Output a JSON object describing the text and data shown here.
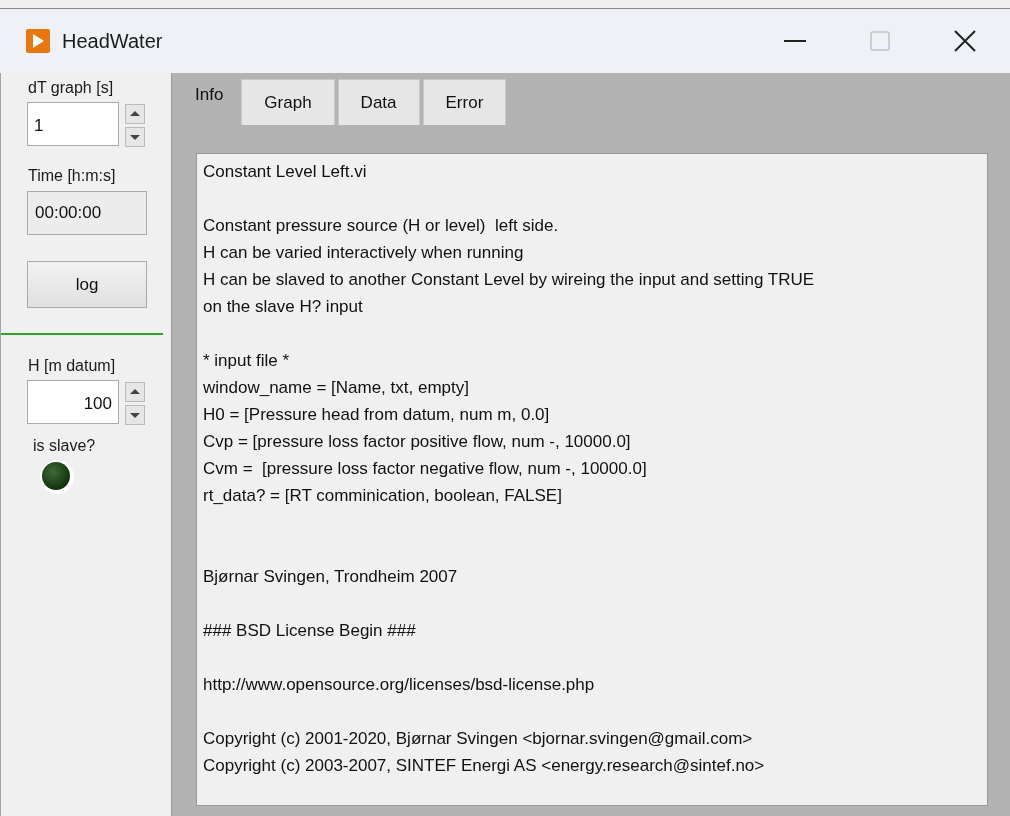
{
  "window": {
    "title": "HeadWater"
  },
  "left_panel": {
    "dt_graph": {
      "label": "dT graph [s]",
      "value": "1"
    },
    "time": {
      "label": "Time [h:m:s]",
      "value": "00:00:00"
    },
    "log_button": "log",
    "h": {
      "label": "H [m datum]",
      "value": "100"
    },
    "is_slave": {
      "label": "is slave?",
      "on": false
    }
  },
  "tabs": [
    {
      "label": "Info",
      "selected": true
    },
    {
      "label": "Graph",
      "selected": false
    },
    {
      "label": "Data",
      "selected": false
    },
    {
      "label": "Error",
      "selected": false
    }
  ],
  "info_text": [
    {
      "kind": "paragraph",
      "lines": [
        "Constant Level Left.vi"
      ]
    },
    {
      "kind": "paragraph",
      "lines": [
        "Constant pressure source (H or level)  left side.",
        "H can be varied interactively when running",
        "H can be slaved to another Constant Level by wireing the input and setting TRUE",
        "on the slave H? input"
      ]
    },
    {
      "kind": "paragraph",
      "lines": [
        "* input file *",
        "window_name = [Name, txt, empty]",
        "H0 = [Pressure head from datum, num m, 0.0]",
        "Cvp = [pressure loss factor positive flow, num -, 10000.0]",
        "Cvm =  [pressure loss factor negative flow, num -, 10000.0]",
        "rt_data? = [RT comminication, boolean, FALSE]"
      ]
    },
    {
      "kind": "spaced",
      "lines": [
        "Bjørnar Svingen, Trondheim 2007"
      ]
    },
    {
      "kind": "paragraph",
      "lines": [
        "### BSD License Begin ###"
      ]
    },
    {
      "kind": "paragraph",
      "lines": [
        "http://www.opensource.org/licenses/bsd-license.php"
      ]
    },
    {
      "kind": "paragraph",
      "lines": [
        "Copyright (c) 2001-2020, Bjørnar Svingen <bjornar.svingen@gmail.com>",
        "Copyright (c) 2003-2007, SINTEF Energi AS <energy.research@sintef.no>"
      ]
    }
  ]
}
